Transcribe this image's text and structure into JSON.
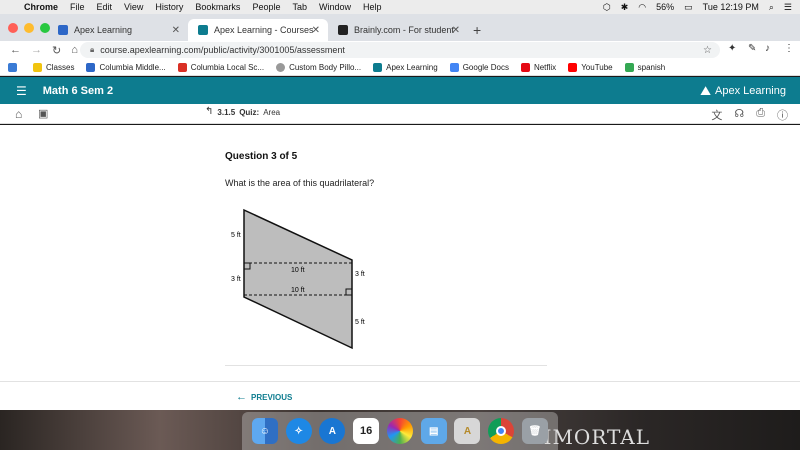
{
  "menubar": {
    "app": "Chrome",
    "items": [
      "File",
      "Edit",
      "View",
      "History",
      "Bookmarks",
      "People",
      "Tab",
      "Window",
      "Help"
    ],
    "battery": "56%",
    "clock": "Tue 12:19 PM"
  },
  "tabs": [
    {
      "title": "Apex Learning",
      "icon_color": "#2d67c7"
    },
    {
      "title": "Apex Learning - Courses",
      "icon_color": "#0d7c8f"
    },
    {
      "title": "Brainly.com - For students. By",
      "icon_color": "#222"
    }
  ],
  "address": {
    "url": "course.apexlearning.com/public/activity/3001005/assessment"
  },
  "bookmarks": [
    {
      "label": "Classes",
      "color": "#f1c40f"
    },
    {
      "label": "Columbia Middle...",
      "color": "#2d67c7"
    },
    {
      "label": "Columbia Local Sc...",
      "color": "#d93025"
    },
    {
      "label": "Custom Body Pillo...",
      "color": "#999"
    },
    {
      "label": "Apex Learning",
      "color": "#0d7c8f"
    },
    {
      "label": "Google Docs",
      "color": "#4285f4"
    },
    {
      "label": "Netflix",
      "color": "#e50914"
    },
    {
      "label": "YouTube",
      "color": "#ff0000"
    },
    {
      "label": "spanish",
      "color": "#34a853"
    }
  ],
  "apex": {
    "course_title": "Math 6 Sem 2",
    "brand": "Apex Learning",
    "accent": "#0d7c8f"
  },
  "breadcrumb": {
    "number": "3.1.5",
    "type": "Quiz:",
    "name": "Area"
  },
  "question": {
    "title": "Question 3 of 5",
    "text": "What is the area of this quadrilateral?"
  },
  "figure": {
    "label_left_top": "5 ft",
    "label_left_bottom": "3 ft",
    "label_middle_top": "10 ft",
    "label_middle_bottom": "10 ft",
    "label_right_top": "3 ft",
    "label_right_bottom": "5 ft"
  },
  "nav": {
    "previous": "PREVIOUS"
  },
  "dock": [
    {
      "name": "finder",
      "color": "#3a8ee6"
    },
    {
      "name": "safari",
      "color": "#1e88e5"
    },
    {
      "name": "app-store",
      "color": "#1976d2"
    },
    {
      "name": "calendar",
      "color": "#ffffff",
      "text": "16"
    },
    {
      "name": "photos",
      "color": "#f5f5f5"
    },
    {
      "name": "preview",
      "color": "#5fa8e8"
    },
    {
      "name": "font-book",
      "color": "#d7d7d7"
    },
    {
      "name": "chrome",
      "color": "#f5f5f5"
    },
    {
      "name": "trash",
      "color": "#9aa0a6"
    }
  ],
  "desktop_text": "MMORTAL"
}
